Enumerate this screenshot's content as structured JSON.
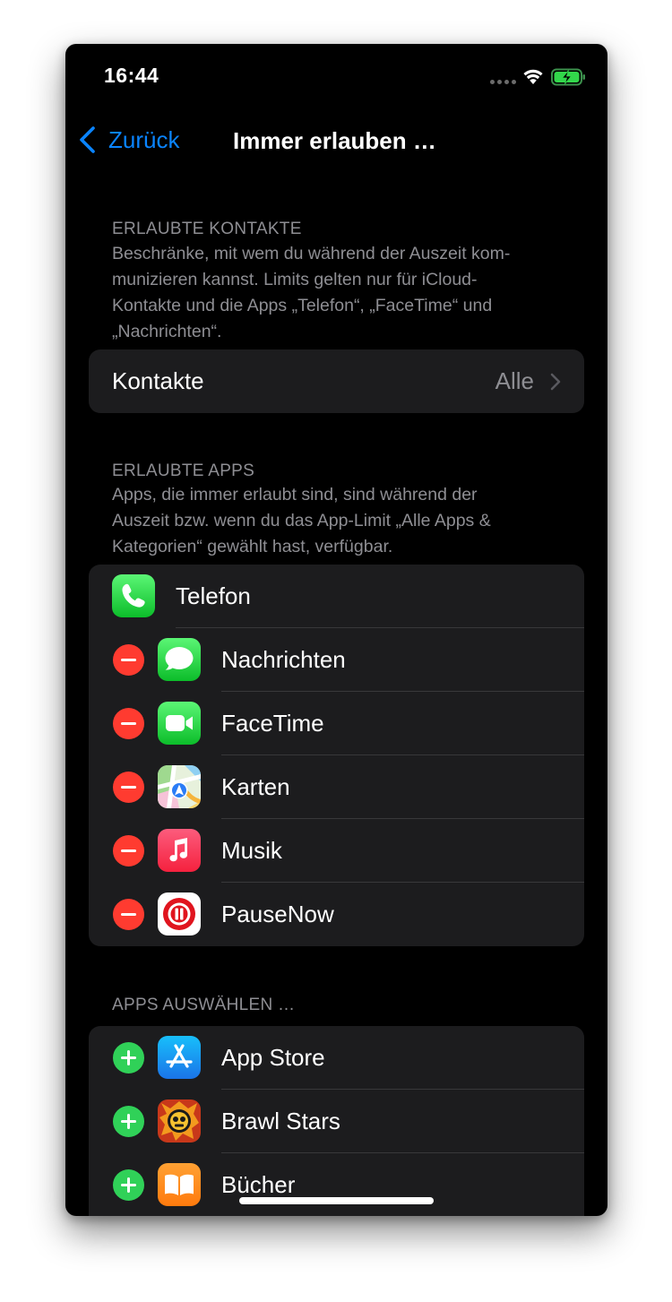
{
  "status": {
    "time": "16:44"
  },
  "nav": {
    "back_label": "Zurück",
    "title": "Immer erlauben …"
  },
  "contacts_section": {
    "header": "ERLAUBTE KONTAKTE",
    "footer_lines": [
      "Beschränke, mit wem du während der Auszeit kom-",
      "munizieren kannst. Limits gelten nur für iCloud-",
      "Kontakte und die Apps „Telefon“, „FaceTime“ und",
      "„Nachrichten“."
    ],
    "row": {
      "label": "Kontakte",
      "value": "Alle"
    }
  },
  "allowed_section": {
    "header": "ERLAUBTE APPS",
    "footer_lines": [
      "Apps, die immer erlaubt sind, sind während der",
      "Auszeit bzw. wenn du das App-Limit „Alle Apps &",
      "Kategorien“ gewählt hast, verfügbar."
    ],
    "apps": [
      {
        "name": "Telefon",
        "icon": "phone-icon",
        "removable": false
      },
      {
        "name": "Nachrichten",
        "icon": "messages-icon",
        "removable": true
      },
      {
        "name": "FaceTime",
        "icon": "facetime-icon",
        "removable": true
      },
      {
        "name": "Karten",
        "icon": "maps-icon",
        "removable": true
      },
      {
        "name": "Musik",
        "icon": "music-icon",
        "removable": true
      },
      {
        "name": "PauseNow",
        "icon": "pausenow-icon",
        "removable": true
      }
    ]
  },
  "choose_section": {
    "header": "APPS AUSWÄHLEN …",
    "apps": [
      {
        "name": "App Store",
        "icon": "app-store-icon"
      },
      {
        "name": "Brawl Stars",
        "icon": "brawl-stars-icon"
      },
      {
        "name": "Bücher",
        "icon": "books-icon"
      }
    ]
  },
  "colors": {
    "accent": "#0a84ff",
    "remove": "#ff3b30",
    "add": "#30d158",
    "background": "#000000",
    "cell": "#1c1c1e",
    "secondary_text": "#8e8e93"
  }
}
